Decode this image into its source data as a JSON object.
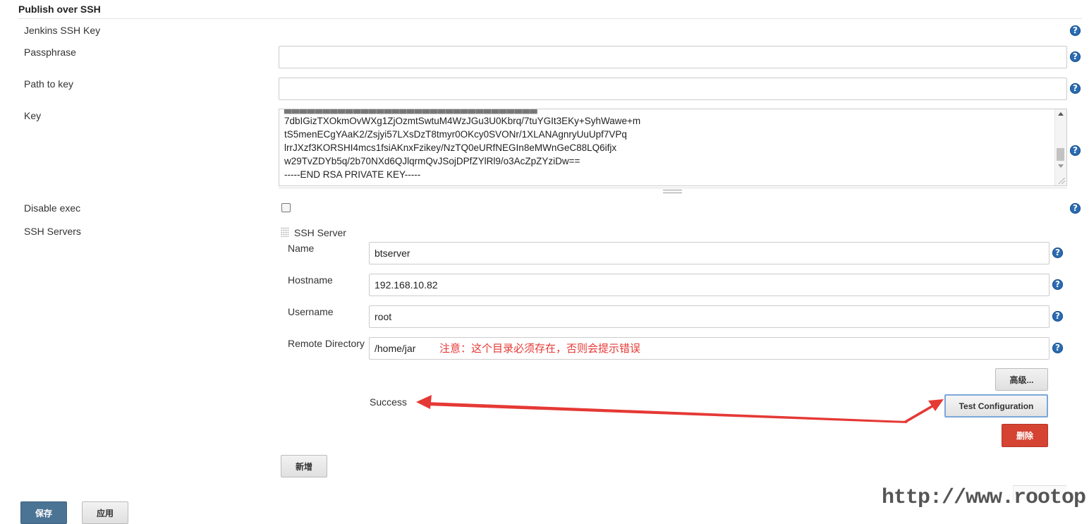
{
  "section": {
    "title": "Publish over SSH"
  },
  "fields": {
    "jenkins_ssh_key_label": "Jenkins SSH Key",
    "passphrase_label": "Passphrase",
    "passphrase_value": "",
    "path_to_key_label": "Path to key",
    "path_to_key_value": "",
    "key_label": "Key",
    "key_lines": [
      "7dbIGizTXOkmOvWXg1ZjOzmtSwtuM4WzJGu3U0Kbrq/7tuYGIt3EKy+SyhWawe+m",
      "tS5menECgYAaK2/Zsjyi57LXsDzT8tmyr0OKcy0SVONr/1XLANAgnryUuUpf7VPq",
      "lrrJXzf3KORSHI4mcs1fsiAKnxFzikey/NzTQ0eURfNEGIn8eMWnGeC88LQ6ifjx",
      "w29TvZDYb5q/2b70NXd6QJlqrmQvJSojDPfZYlRl9/o3AcZpZYziDw==",
      "-----END RSA PRIVATE KEY-----"
    ],
    "disable_exec_label": "Disable exec",
    "ssh_servers_label": "SSH Servers"
  },
  "ssh_server": {
    "title": "SSH Server",
    "name_label": "Name",
    "name_value": "btserver",
    "hostname_label": "Hostname",
    "hostname_value": "192.168.10.82",
    "username_label": "Username",
    "username_value": "root",
    "remote_dir_label": "Remote Directory",
    "remote_dir_value": "/home/jar",
    "remote_dir_note": "注意：这个目录必须存在，否则会提示错误",
    "advanced_button": "高级...",
    "status_text": "Success",
    "test_button": "Test Configuration",
    "delete_button": "删除"
  },
  "add_button": "新增",
  "footer": {
    "save_button": "保存",
    "apply_button": "应用"
  },
  "help_glyph": "?",
  "watermark": "http://www.rootop.org",
  "colors": {
    "help": "#2a6cb3",
    "annotation": "#e53935",
    "delete": "#d54332",
    "save": "#4b7394",
    "test_border": "#7ba7d9"
  }
}
